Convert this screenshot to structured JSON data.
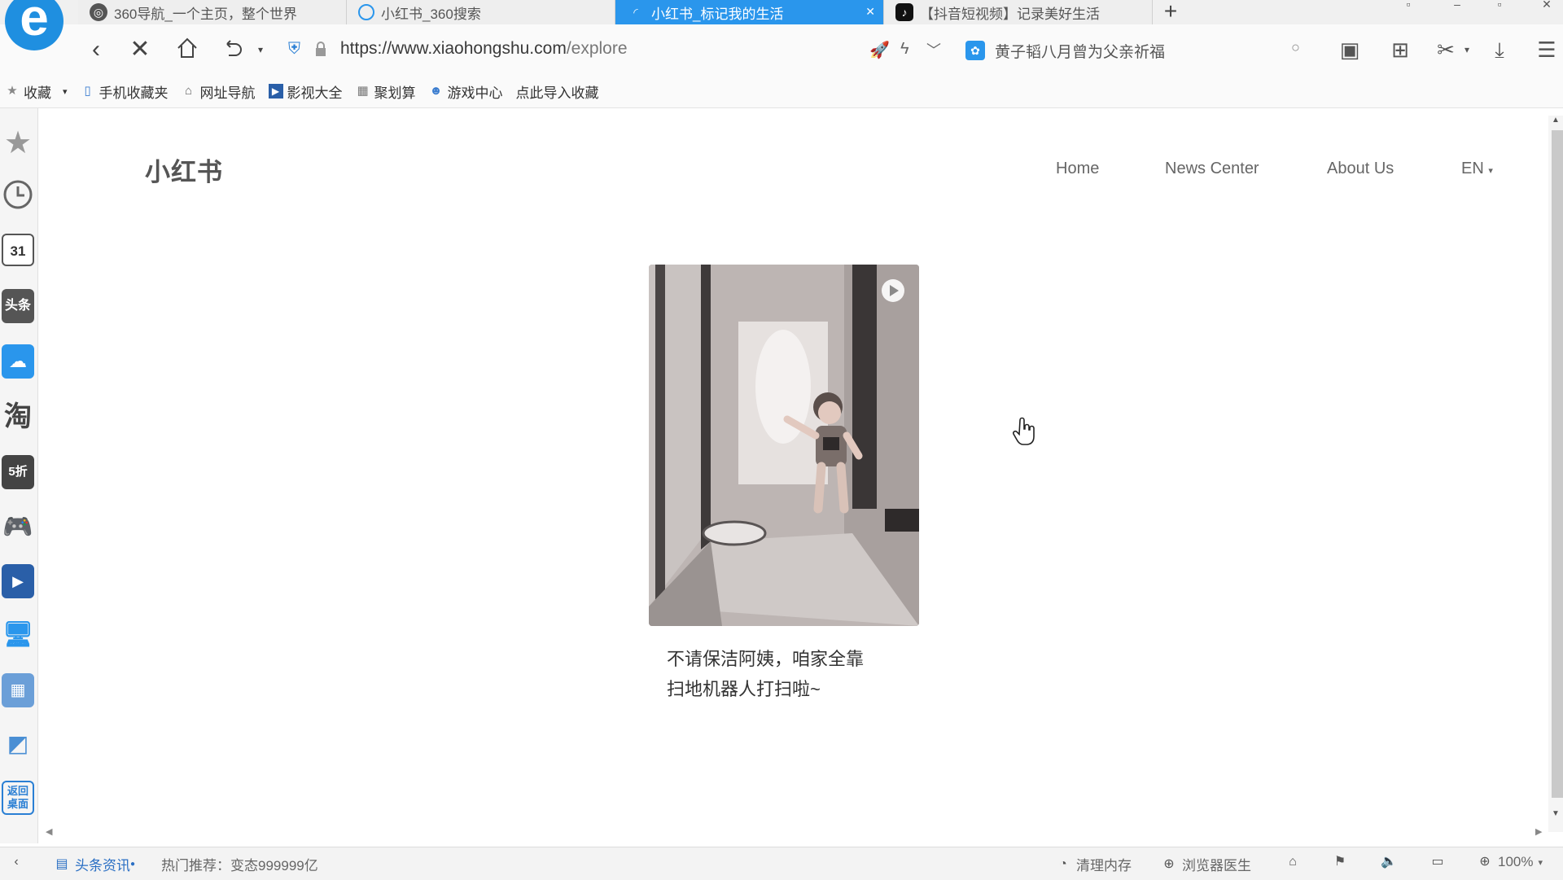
{
  "tabs": [
    {
      "title": "360导航_一个主页，整个世界",
      "icon": "globe-icon"
    },
    {
      "title": "小红书_360搜索",
      "icon": "search-icon"
    },
    {
      "title": "小红书_标记我的生活",
      "icon": "loading-icon",
      "active": true
    },
    {
      "title": "【抖音短视频】记录美好生活",
      "icon": "tiktok-icon"
    }
  ],
  "new_tab_glyph": "+",
  "address_bar": {
    "url_host": "https://www.xiaohongshu.com",
    "url_path": "/explore",
    "news_text": "黄子韬八月曾为父亲祈福"
  },
  "bookmarks": [
    {
      "label": "收藏",
      "icon": "star-icon"
    },
    {
      "label": "手机收藏夹",
      "icon": "phone-icon"
    },
    {
      "label": "网址导航",
      "icon": "home-icon"
    },
    {
      "label": "影视大全",
      "icon": "film-icon"
    },
    {
      "label": "聚划算",
      "icon": "grid-icon"
    },
    {
      "label": "游戏中心",
      "icon": "game-icon"
    },
    {
      "label": "点此导入收藏",
      "icon": ""
    }
  ],
  "sidebar": {
    "calendar_day": "31",
    "toutiao_label": "头条",
    "taobao_label": "淘",
    "discount_label": "5折",
    "desktop_label": "返回桌面"
  },
  "site": {
    "brand": "小红书",
    "nav": {
      "home": "Home",
      "news": "News Center",
      "about": "About Us",
      "lang": "EN"
    }
  },
  "post": {
    "caption_line1": "不请保洁阿姨，咱家全靠",
    "caption_line2": "扫地机器人打扫啦~"
  },
  "statusbar": {
    "headline_label": "头条资讯",
    "hot_text": "热门推荐：变态999999亿",
    "clear_memory": "清理内存",
    "doctor": "浏览器医生",
    "zoom": "100%"
  },
  "colors": {
    "active_tab": "#2a96ec",
    "browser_logo": "#1f8fe0",
    "link_blue": "#3a7ccf"
  }
}
